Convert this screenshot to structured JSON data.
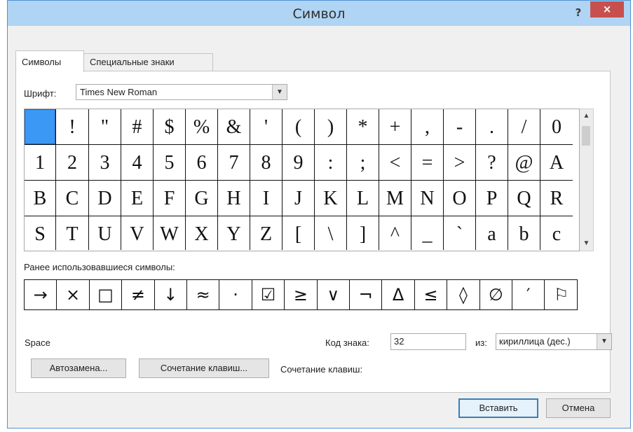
{
  "window": {
    "title": "Символ",
    "help": "?",
    "close": "×"
  },
  "tabs": {
    "symbols": "Символы",
    "special": "Специальные знаки"
  },
  "font": {
    "label": "Шрифт:",
    "value": "Times New Roman"
  },
  "grid": {
    "rows": [
      [
        "",
        "!",
        "\"",
        "#",
        "$",
        "%",
        "&",
        "'",
        "(",
        ")",
        "*",
        "+",
        ",",
        "-",
        ".",
        "/",
        "0"
      ],
      [
        "1",
        "2",
        "3",
        "4",
        "5",
        "6",
        "7",
        "8",
        "9",
        ":",
        ";",
        "<",
        "=",
        ">",
        "?",
        "@",
        "A"
      ],
      [
        "B",
        "C",
        "D",
        "E",
        "F",
        "G",
        "H",
        "I",
        "J",
        "K",
        "L",
        "M",
        "N",
        "O",
        "P",
        "Q",
        "R"
      ],
      [
        "S",
        "T",
        "U",
        "V",
        "W",
        "X",
        "Y",
        "Z",
        "[",
        "\\",
        "]",
        "^",
        "_",
        "`",
        "a",
        "b",
        "c"
      ]
    ],
    "selected": "0,0"
  },
  "recent": {
    "label": "Ранее использовавшиеся символы:",
    "symbols": [
      "→",
      "×",
      "□",
      "≠",
      "↓",
      "≈",
      "·",
      "☑",
      "≥",
      "∨",
      "¬",
      "Δ",
      "≤",
      "◊",
      "∅",
      "′",
      "⚐"
    ]
  },
  "info": {
    "char_name": "Space",
    "code_label": "Код знака:",
    "code_value": "32",
    "from_label": "из:",
    "from_value": "кириллица (дес.)"
  },
  "buttons": {
    "autocorrect": "Автозамена...",
    "shortcut": "Сочетание клавиш...",
    "shortcut_label": "Сочетание клавиш:",
    "insert": "Вставить",
    "cancel": "Отмена"
  },
  "colors": {
    "selection": "#3c98f5",
    "title_bar": "#b0d4f3",
    "close": "#c7504e"
  }
}
